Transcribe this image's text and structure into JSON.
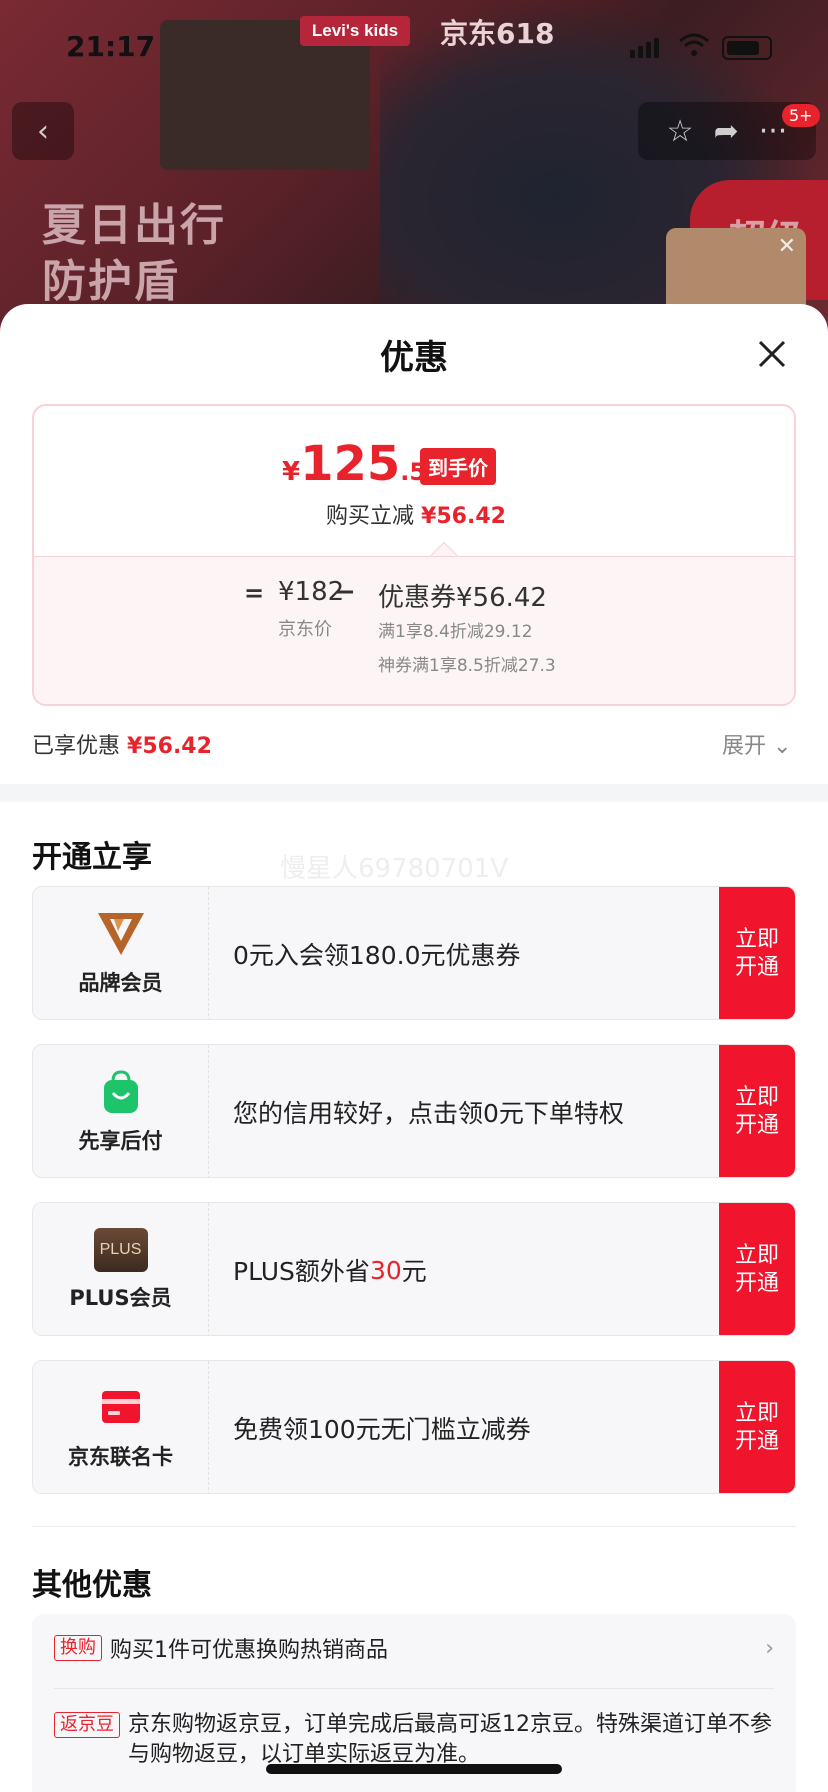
{
  "status_bar": {
    "time": "21:17"
  },
  "background": {
    "brand_logo": "Levi's kids",
    "campaign": "京东618",
    "slogan_line1": "夏日出行",
    "slogan_line2": "防护盾",
    "promo_text": "超级",
    "more_badge": "5+"
  },
  "sheet": {
    "title": "优惠",
    "price": {
      "currency": "¥",
      "integer": "125",
      "decimal": ".58",
      "tag": "到手价",
      "save_label": "购买立减",
      "save_value": "¥56.42"
    },
    "breakdown": {
      "equals": "=",
      "jd_price": "¥182",
      "jd_price_label": "京东价",
      "minus": "−",
      "coupon": "优惠券¥56.42",
      "detail1": "满1享8.4折减29.12",
      "detail2": "神券满1享8.5折减27.3"
    },
    "enjoyed_label": "已享优惠",
    "enjoyed_value": "¥56.42",
    "expand_label": "展开"
  },
  "open_section": {
    "title": "开通立享",
    "watermark": "慢星人69780701V",
    "items": [
      {
        "label": "品牌会员",
        "desc": "0元入会领180.0元优惠券",
        "button": "立即开通"
      },
      {
        "label": "先享后付",
        "desc": "您的信用较好，点击领0元下单特权",
        "button": "立即开通"
      },
      {
        "label": "PLUS会员",
        "icon_text": "PLUS",
        "desc_pre": "PLUS额外省",
        "desc_num": "30",
        "desc_post": "元",
        "button": "立即开通"
      },
      {
        "label": "京东联名卡",
        "desc": "免费领100元无门槛立减券",
        "button": "立即开通"
      }
    ]
  },
  "other_section": {
    "title": "其他优惠",
    "items": [
      {
        "tag": "换购",
        "text": "购买1件可优惠换购热销商品"
      },
      {
        "tag": "返京豆",
        "text": "京东购物返京豆，订单完成后最高可返12京豆。特殊渠道订单不参与购物返豆，以订单实际返豆为准。"
      }
    ]
  },
  "colors": {
    "accent": "#e8232c",
    "button": "#f0142c"
  }
}
